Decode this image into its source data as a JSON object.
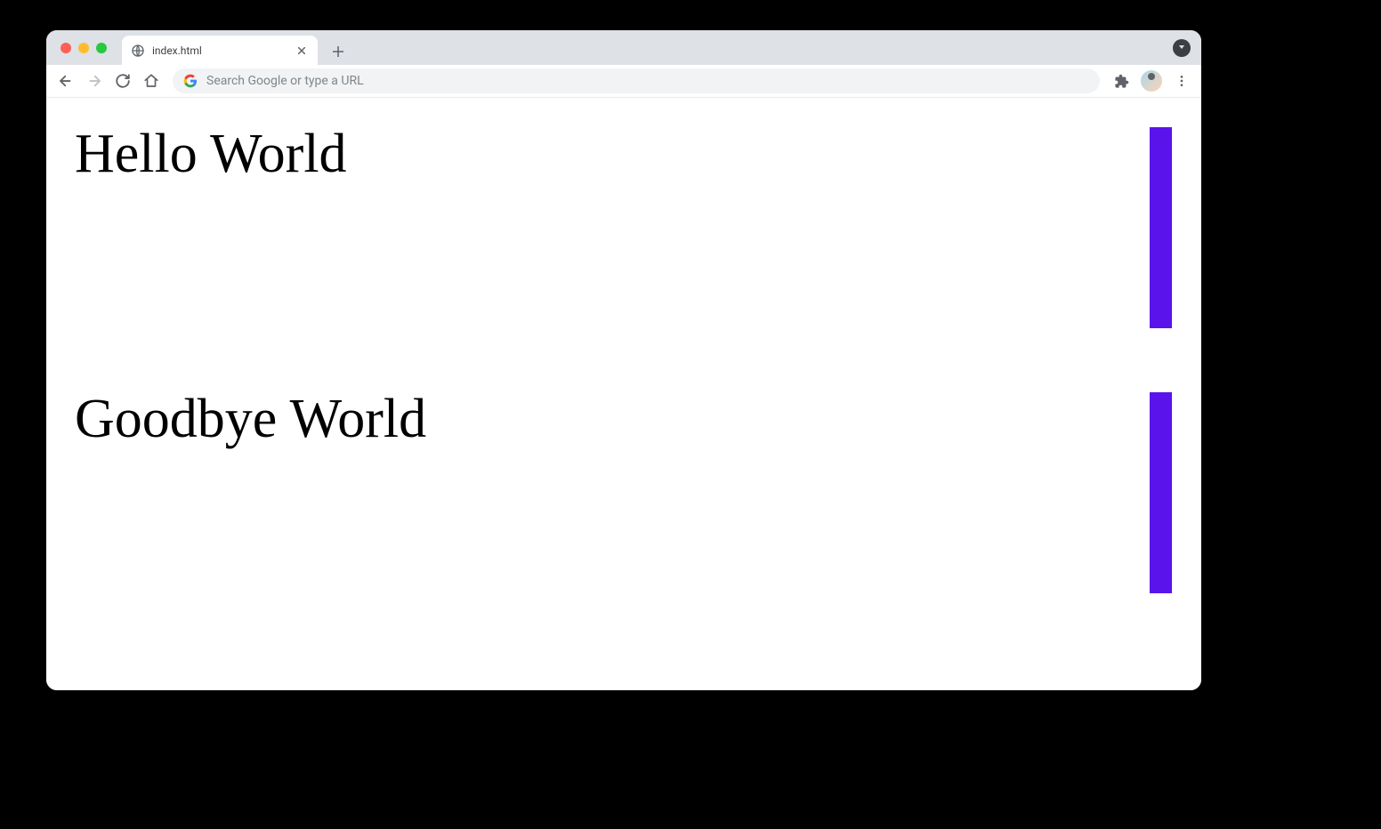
{
  "tab": {
    "title": "index.html"
  },
  "toolbar": {
    "address_placeholder": "Search Google or type a URL"
  },
  "page": {
    "heading_1": "Hello World",
    "heading_2": "Goodbye World",
    "bar_color": "#5b13ec"
  }
}
